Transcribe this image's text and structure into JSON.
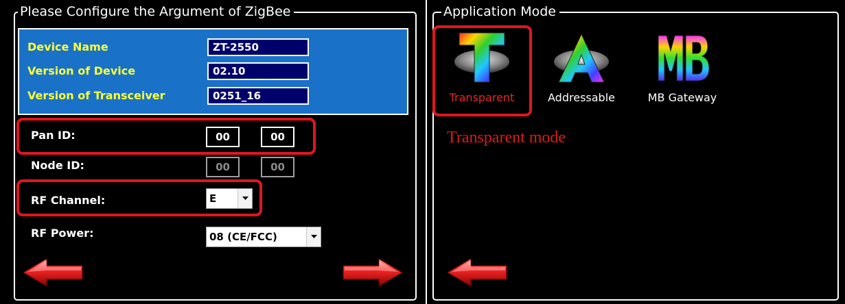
{
  "left": {
    "title": "Please Configure the Argument of ZigBee",
    "info": {
      "device_name_label": "Device Name",
      "device_name_value": "ZT-2550",
      "version_device_label": "Version of Device",
      "version_device_value": "02.10",
      "version_transceiver_label": "Version of Transceiver",
      "version_transceiver_value": "0251_16"
    },
    "pan_id": {
      "label": "Pan ID:",
      "high": "00",
      "low": "00"
    },
    "node_id": {
      "label": "Node ID:",
      "high": "00",
      "low": "00"
    },
    "rf_channel": {
      "label": "RF Channel:",
      "value": "E"
    },
    "rf_power": {
      "label": "RF Power:",
      "value": "08 (CE/FCC)"
    },
    "icons": {
      "back": "back-arrow-icon",
      "next": "next-arrow-icon"
    }
  },
  "right": {
    "title": "Application Mode",
    "modes": [
      {
        "label": "Transparent",
        "icon": "transparent-mode-icon",
        "selected": true
      },
      {
        "label": "Addressable",
        "icon": "addressable-mode-icon",
        "selected": false
      },
      {
        "label": "MB Gateway",
        "icon": "mb-gateway-mode-icon",
        "selected": false
      }
    ],
    "caption": "Transparent mode",
    "icons": {
      "back": "back-arrow-icon"
    }
  },
  "colors": {
    "background": "#000000",
    "info_box": "#1a72c8",
    "label_yellow": "#ffff33",
    "value_box": "#00006b",
    "highlight_red": "#e0161e"
  }
}
